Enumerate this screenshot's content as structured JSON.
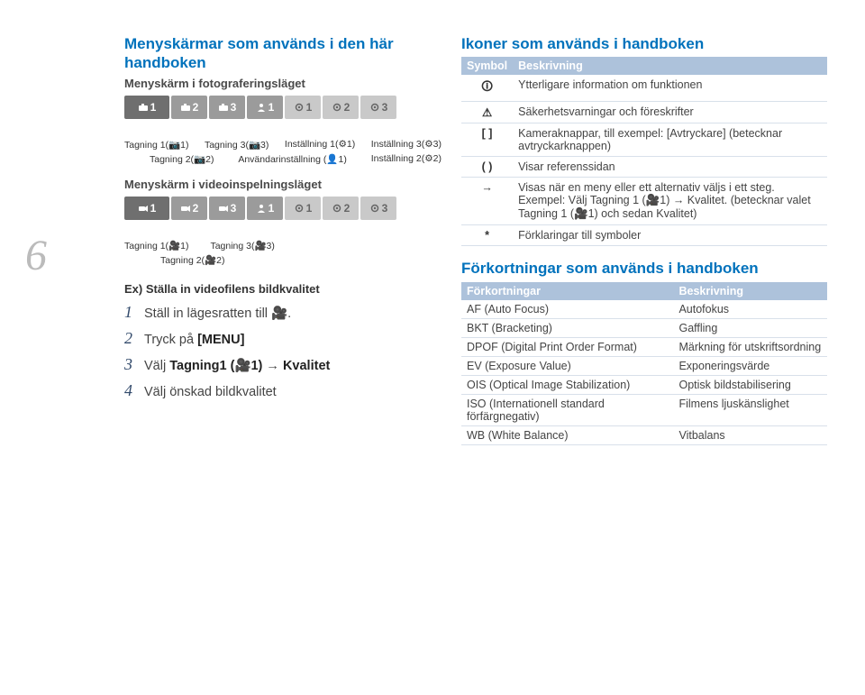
{
  "pageNumber": "6",
  "left": {
    "title1": "Menyskärmar som används i den här handboken",
    "caption1": "Menyskärm i fotograferingsläget",
    "tabs1": [
      "1",
      "2",
      "3",
      "1",
      "1",
      "2",
      "3"
    ],
    "labels1_line1": {
      "tag1": "Tagning 1(📷1)",
      "tag3": "Tagning 3(📷3)",
      "inst1": "Inställning 1(⚙1)",
      "inst3": "Inställning 3(⚙3)"
    },
    "labels1_line2": {
      "tag2": "Tagning 2(📷2)",
      "user1": "Användarinställning (👤1)",
      "inst2": "Inställning 2(⚙2)"
    },
    "caption2": "Menyskärm i videoinspelningsläget",
    "tabs2": [
      "1",
      "2",
      "3",
      "1",
      "1",
      "2",
      "3"
    ],
    "labels2_line1": {
      "tag1": "Tagning 1(🎥1)",
      "tag3": "Tagning 3(🎥3)"
    },
    "labels2_line2": {
      "tag2": "Tagning 2(🎥2)"
    },
    "exampleTitle": "Ex) Ställa in videofilens bildkvalitet",
    "steps": [
      {
        "n": "1",
        "t": "Ställ in lägesratten till 🎥."
      },
      {
        "n": "2",
        "t": "Tryck på ",
        "b": "[MENU]",
        "t2": ""
      },
      {
        "n": "3",
        "t": "Välj ",
        "b": "Tagning1 (🎥1)",
        "t2": " → ",
        "b2": "Kvalitet"
      },
      {
        "n": "4",
        "t": "Välj önskad bildkvalitet"
      }
    ]
  },
  "right": {
    "iconsTitle": "Ikoner som används i handboken",
    "symbolHeaders": {
      "col1": "Symbol",
      "col2": "Beskrivning"
    },
    "symbolRows": [
      {
        "s": "🛈",
        "d": "Ytterligare information om funktionen"
      },
      {
        "s": "⚠",
        "d": "Säkerhetsvarningar och föreskrifter"
      },
      {
        "s": "[ ]",
        "d": "Kameraknappar, till exempel: [Avtryckare] (betecknar avtryckarknappen)"
      },
      {
        "s": "( )",
        "d": "Visar referenssidan"
      },
      {
        "s": "→",
        "d": "Visas när en meny eller ett alternativ väljs i ett steg.\nExempel: Välj Tagning 1 (🎥1) → Kvalitet. (betecknar valet Tagning 1 (🎥1) och sedan Kvalitet)"
      },
      {
        "s": "*",
        "d": "Förklaringar till symboler"
      }
    ],
    "abbrTitle": "Förkortningar som används i handboken",
    "abbrHeaders": {
      "col1": "Förkortningar",
      "col2": "Beskrivning"
    },
    "abbrRows": [
      {
        "a": "AF (Auto Focus)",
        "b": "Autofokus"
      },
      {
        "a": "BKT (Bracketing)",
        "b": "Gaffling"
      },
      {
        "a": "DPOF (Digital Print Order Format)",
        "b": "Märkning för utskriftsordning"
      },
      {
        "a": "EV (Exposure Value)",
        "b": "Exponeringsvärde"
      },
      {
        "a": "OIS (Optical Image Stabilization)",
        "b": "Optisk bildstabilisering"
      },
      {
        "a": "ISO (Internationell standard förfärgnegativ)",
        "b": "Filmens ljuskänslighet"
      },
      {
        "a": "WB (White Balance)",
        "b": "Vitbalans"
      }
    ]
  }
}
